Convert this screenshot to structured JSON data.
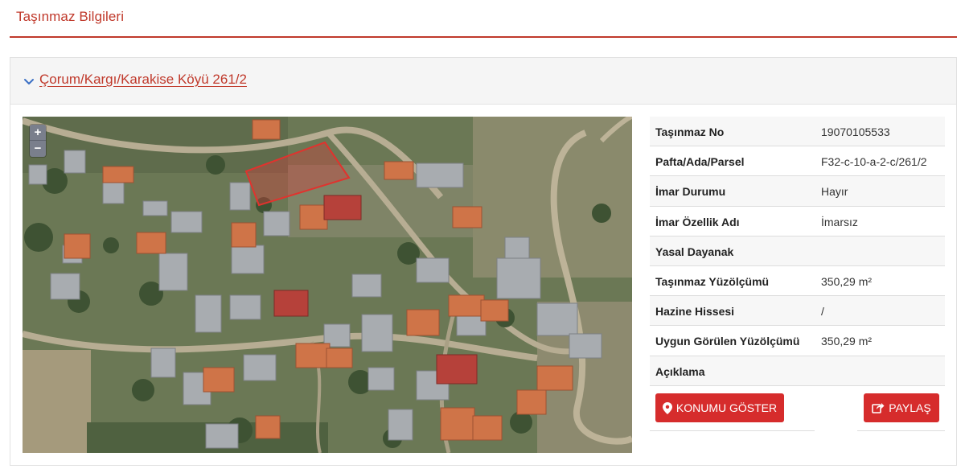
{
  "page": {
    "title": "Taşınmaz Bilgileri"
  },
  "card": {
    "link_text": "Çorum/Kargı/Karakise Köyü 261/2"
  },
  "map": {
    "zoom_in": "+",
    "zoom_out": "−"
  },
  "info": {
    "rows": [
      {
        "label": "Taşınmaz No",
        "value": "19070105533"
      },
      {
        "label": "Pafta/Ada/Parsel",
        "value": "F32-c-10-a-2-c/261/2"
      },
      {
        "label": "İmar Durumu",
        "value": "Hayır"
      },
      {
        "label": "İmar Özellik Adı",
        "value": "İmarsız"
      },
      {
        "label": "Yasal Dayanak",
        "value": ""
      },
      {
        "label": "Taşınmaz Yüzölçümü",
        "value": "350,29 m²"
      },
      {
        "label": "Hazine Hissesi",
        "value": "/"
      },
      {
        "label": "Uygun Görülen Yüzölçümü",
        "value": "350,29 m²"
      },
      {
        "label": "Açıklama",
        "value": ""
      }
    ]
  },
  "actions": {
    "location_label": "KONUMU GÖSTER",
    "share_label": "PAYLAŞ"
  },
  "colors": {
    "accent": "#c0392b",
    "button": "#d62c2c"
  }
}
